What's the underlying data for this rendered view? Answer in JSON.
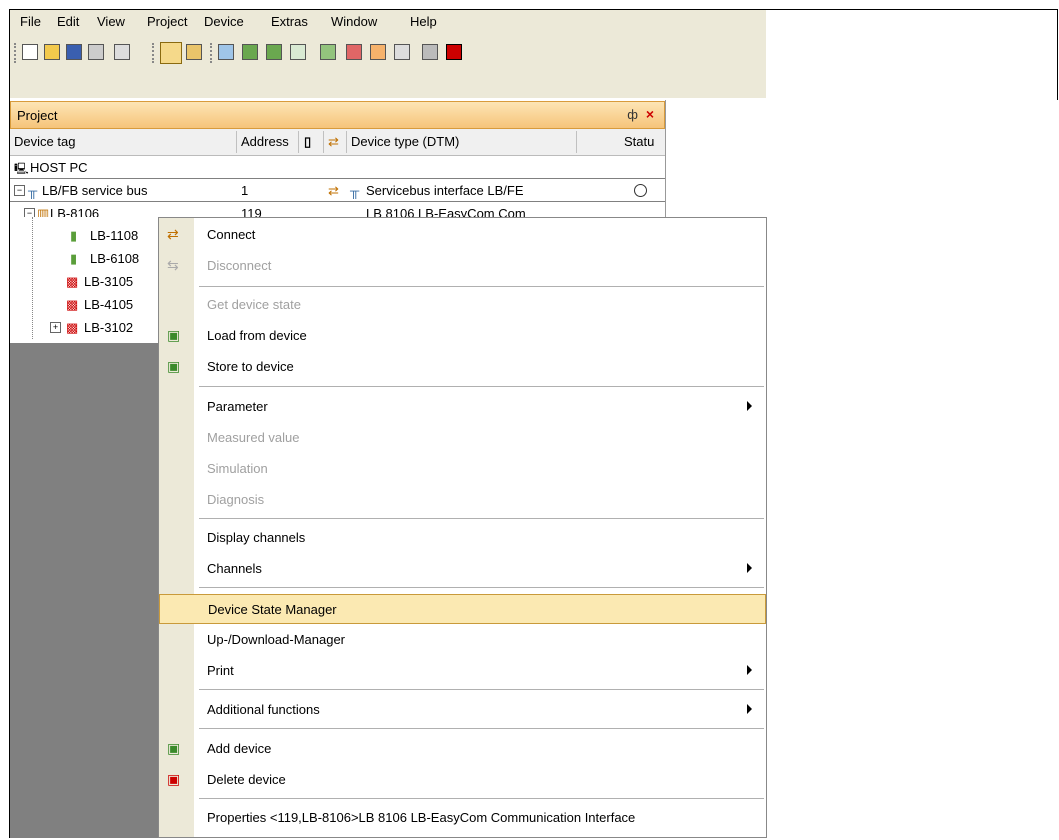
{
  "menubar": [
    "File",
    "Edit",
    "View",
    "Project",
    "Device",
    "Extras",
    "Window",
    "Help"
  ],
  "pane": {
    "title": "Project",
    "pin": "ф",
    "close": "×"
  },
  "columns": {
    "device_tag": "Device tag",
    "address": "Address",
    "device_type": "Device type (DTM)",
    "status": "Statu"
  },
  "rows": {
    "host": "HOST PC",
    "bus_tag": "LB/FB service bus",
    "bus_address": "1",
    "bus_type": "Servicebus interface LB/FE",
    "lb8106": "LB-8106",
    "lb8106_address": "119",
    "lb8106_type": "LB 8106 LB-EasyCom Com",
    "children": [
      "LB-1108",
      "LB-6108",
      "LB-3105",
      "LB-4105",
      "LB-3102"
    ]
  },
  "context_menu": [
    {
      "label": "Connect",
      "enabled": true,
      "icon": "connect-icon"
    },
    {
      "label": "Disconnect",
      "enabled": false,
      "icon": "disconnect-icon"
    },
    {
      "label": "Get device state",
      "enabled": false
    },
    {
      "label": "Load from device",
      "enabled": true,
      "icon": "load-from-device-icon"
    },
    {
      "label": "Store to device",
      "enabled": true,
      "icon": "store-to-device-icon"
    },
    {
      "label": "Parameter",
      "enabled": true,
      "submenu": true
    },
    {
      "label": "Measured value",
      "enabled": false
    },
    {
      "label": "Simulation",
      "enabled": false
    },
    {
      "label": "Diagnosis",
      "enabled": false
    },
    {
      "label": "Display channels",
      "enabled": true
    },
    {
      "label": "Channels",
      "enabled": true,
      "submenu": true
    },
    {
      "label": "Device State Manager",
      "enabled": true,
      "highlighted": true
    },
    {
      "label": "Up-/Download-Manager",
      "enabled": true
    },
    {
      "label": "Print",
      "enabled": true,
      "submenu": true
    },
    {
      "label": "Additional functions",
      "enabled": true,
      "submenu": true
    },
    {
      "label": "Add device",
      "enabled": true,
      "icon": "add-device-icon"
    },
    {
      "label": "Delete device",
      "enabled": true,
      "icon": "delete-device-icon"
    },
    {
      "label": "Properties <119,LB-8106>LB 8106 LB-EasyCom Communication Interface",
      "enabled": true
    }
  ],
  "colors": {
    "highlight": "#fbe9b2",
    "pane_header": "#f6c47a",
    "chrome": "#ece9d8"
  }
}
